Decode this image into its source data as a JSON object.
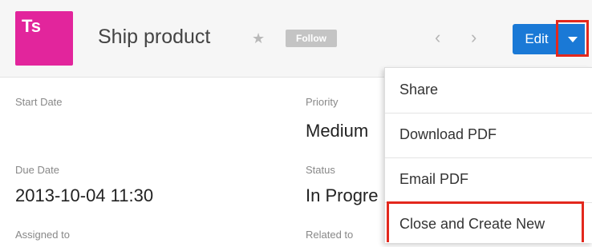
{
  "header": {
    "avatar_initials": "Ts",
    "title": "Ship product",
    "follow_label": "Follow",
    "edit_label": "Edit"
  },
  "fields": {
    "start_date_label": "Start Date",
    "start_date_value": "",
    "priority_label": "Priority",
    "priority_value": "Medium",
    "due_date_label": "Due Date",
    "due_date_value": "2013-10-04 11:30",
    "status_label": "Status",
    "status_value": "In Progre",
    "assigned_label": "Assigned to",
    "related_label": "Related to"
  },
  "menu": {
    "items": [
      {
        "label": "Share"
      },
      {
        "label": "Download PDF"
      },
      {
        "label": "Email PDF"
      },
      {
        "label": "Close and Create New"
      }
    ]
  },
  "colors": {
    "avatar": "#e2259c",
    "primary_button": "#1a79d6",
    "highlight": "#e3281d"
  }
}
